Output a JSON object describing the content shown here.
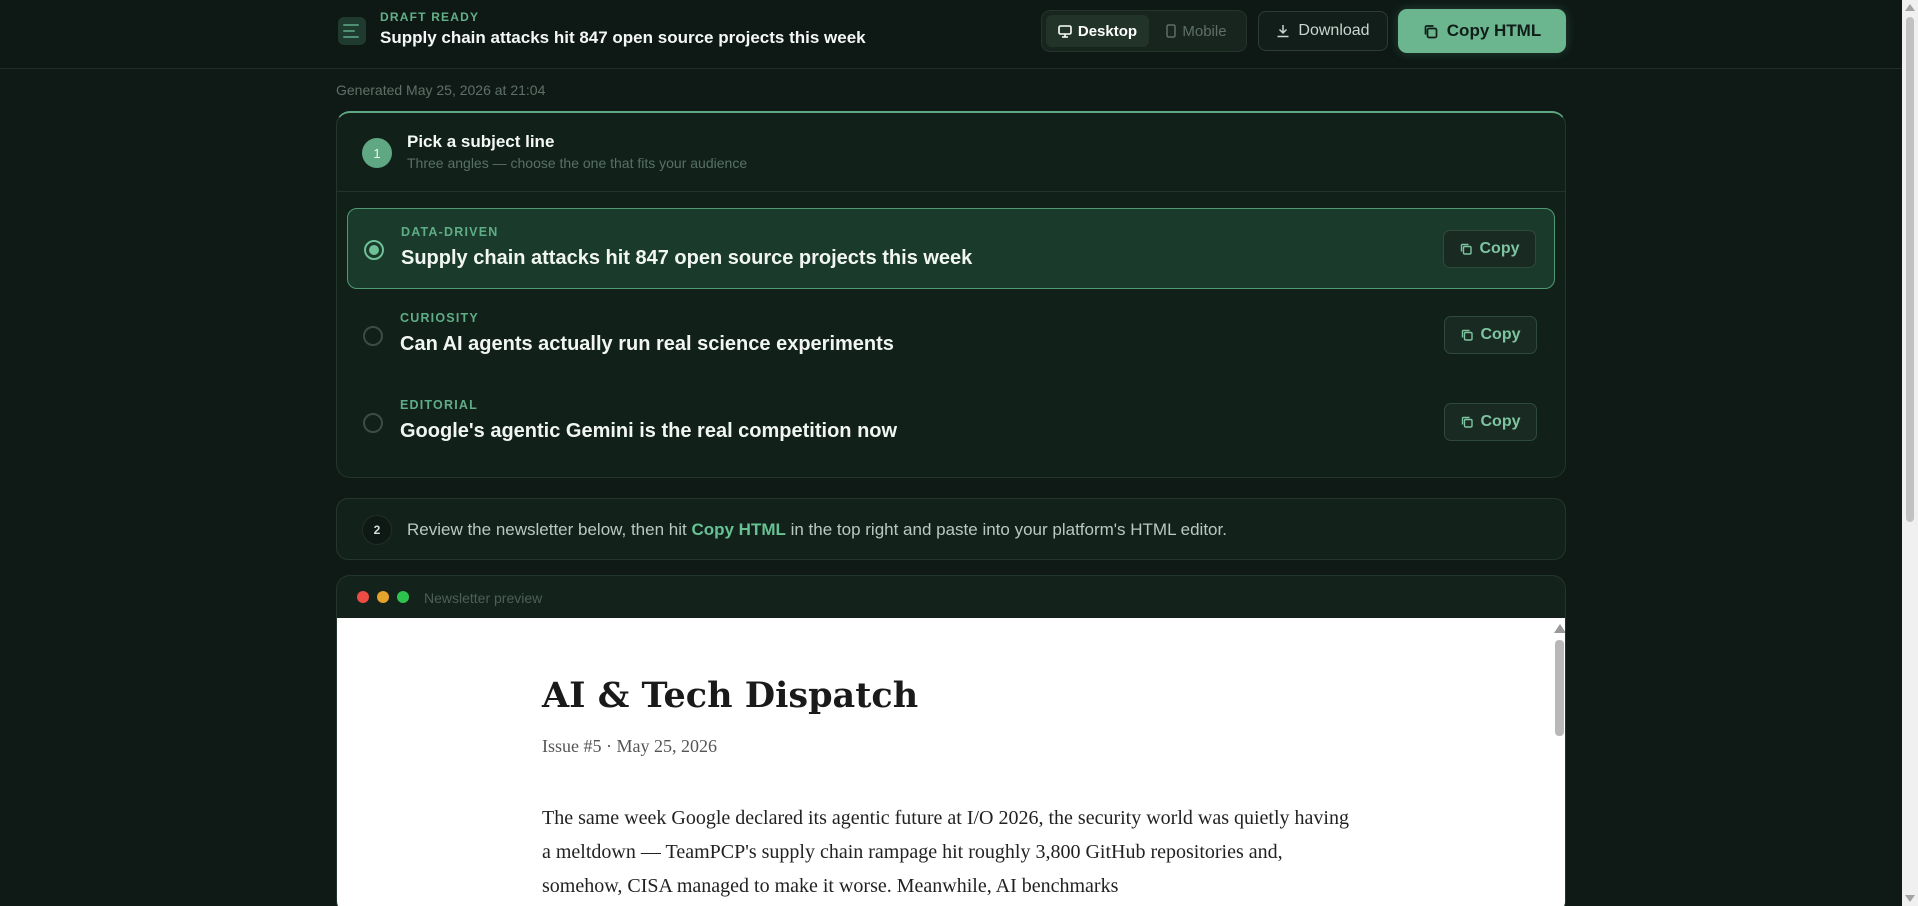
{
  "header": {
    "status": "DRAFT READY",
    "title": "Supply chain attacks hit 847 open source projects this week",
    "view_toggle": {
      "desktop": "Desktop",
      "mobile": "Mobile",
      "active": "Desktop"
    },
    "download_label": "Download",
    "copy_html_label": "Copy HTML"
  },
  "generated": "Generated May 25, 2026 at 21:04",
  "step1": {
    "number": "1",
    "title": "Pick a subject line",
    "subtitle": "Three angles — choose the one that fits your audience",
    "options": [
      {
        "angle": "DATA-DRIVEN",
        "text": "Supply chain attacks hit 847 open source projects this week",
        "copy": "Copy",
        "selected": true
      },
      {
        "angle": "CURIOSITY",
        "text": "Can AI agents actually run real science experiments",
        "copy": "Copy",
        "selected": false
      },
      {
        "angle": "EDITORIAL",
        "text": "Google's agentic Gemini is the real competition now",
        "copy": "Copy",
        "selected": false
      }
    ]
  },
  "step2": {
    "number": "2",
    "text_before": "Review the newsletter below, then hit ",
    "highlight": "Copy HTML",
    "text_after": " in the top right and paste into your platform's HTML editor."
  },
  "preview": {
    "label": "Newsletter preview",
    "newsletter": {
      "title": "AI & Tech Dispatch",
      "meta": "Issue #5 · May 25, 2026",
      "body": "The same week Google declared its agentic future at I/O 2026, the security world was quietly having a meltdown — TeamPCP's supply chain rampage hit roughly 3,800 GitHub repositories and, somehow, CISA managed to make it worse. Meanwhile, AI benchmarks"
    }
  },
  "colors": {
    "background": "#0f1a16",
    "accent": "#6bb58f",
    "accent_text": "#66c293",
    "dot_red": "#ed4c45",
    "dot_yellow": "#e4a32a",
    "dot_green": "#2ec24f"
  }
}
